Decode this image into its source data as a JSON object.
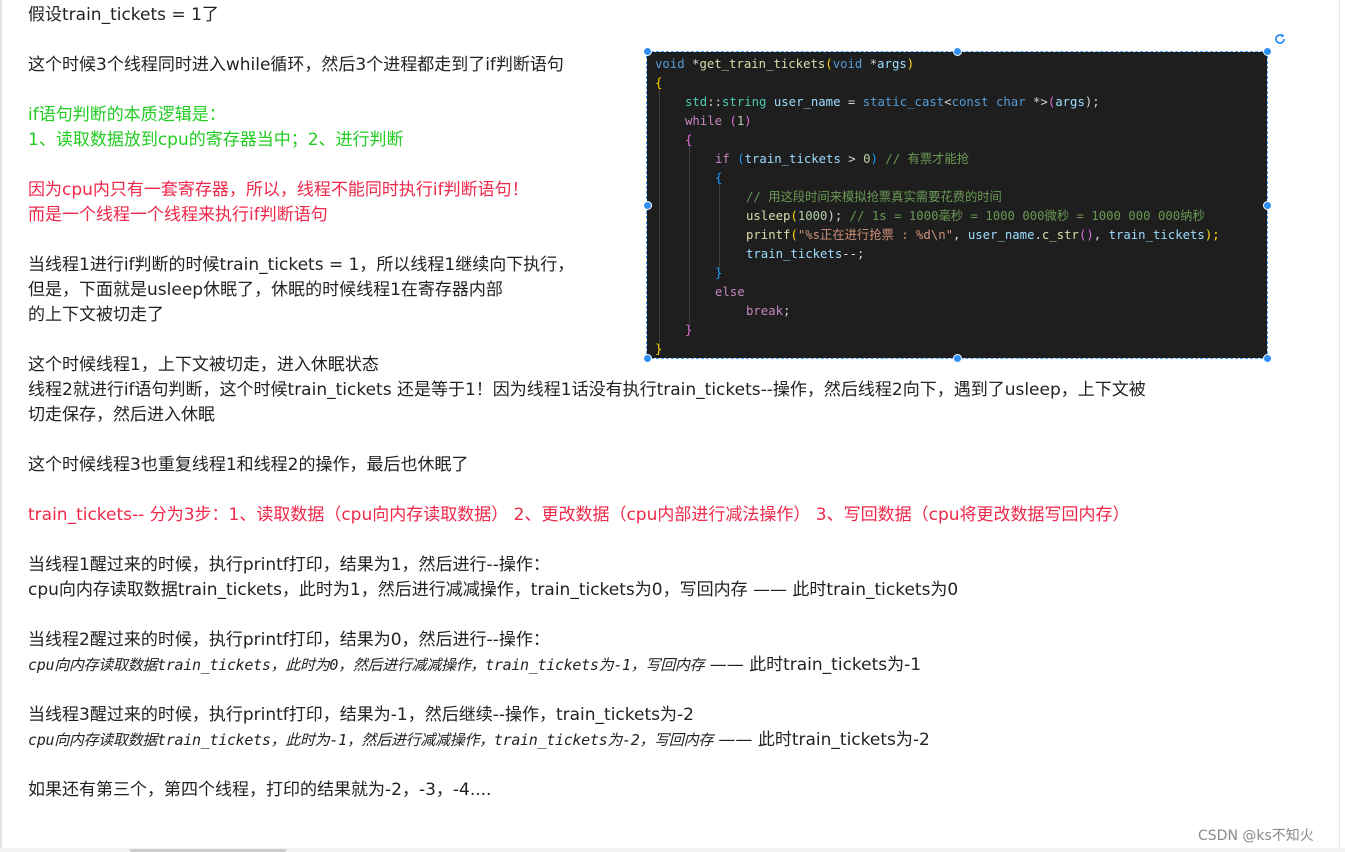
{
  "text": {
    "l1": "假设train_tickets = 1了",
    "l2": "这个时候3个线程同时进入while循环，然后3个进程都走到了if判断语句",
    "l3": "if语句判断的本质逻辑是：",
    "l4": "1、读取数据放到cpu的寄存器当中；2、进行判断",
    "l5": "因为cpu内只有一套寄存器，所以，线程不能同时执行if判断语句！",
    "l6": "而是一个线程一个线程来执行if判断语句",
    "l7": "当线程1进行if判断的时候train_tickets = 1，所以线程1继续向下执行，",
    "l8": "但是，下面就是usleep休眠了，休眠的时候线程1在寄存器内部",
    "l9": "的上下文被切走了",
    "l10": "这个时候线程1，上下文被切走，进入休眠状态",
    "l11": "线程2就进行if语句判断，这个时候train_tickets 还是等于1！因为线程1话没有执行train_tickets--操作，然后线程2向下，遇到了usleep，上下文被",
    "l12": "切走保存，然后进入休眠",
    "l13": "这个时候线程3也重复线程1和线程2的操作，最后也休眠了",
    "l14": "train_tickets-- 分为3步：1、读取数据（cpu向内存读取数据） 2、更改数据（cpu内部进行减法操作） 3、写回数据（cpu将更改数据写回内存）",
    "l15": "当线程1醒过来的时候，执行printf打印，结果为1，然后进行--操作：",
    "l16": "cpu向内存读取数据train_tickets，此时为1，然后进行减减操作，train_tickets为0，写回内存 —— 此时train_tickets为0",
    "l17": "当线程2醒过来的时候，执行printf打印，结果为0，然后进行--操作：",
    "l18a": "cpu向内存读取数据train_tickets，此时为0，然后进行减减操作，train_tickets为-1，写回内存",
    "l18b": " —— 此时train_tickets为-1",
    "l19": "当线程3醒过来的时候，执行printf打印，结果为-1，然后继续--操作，train_tickets为-2",
    "l20a": "cpu向内存读取数据train_tickets，此时为-1，然后进行减减操作，train_tickets为-2，写回内存",
    "l20b": " —— 此时train_tickets为-2",
    "l21": "如果还有第三个，第四个线程，打印的结果就为-2，-3，-4...."
  },
  "code": {
    "c1a": "void",
    "c1b": " *",
    "c1c": "get_train_tickets",
    "c1d": "(",
    "c1e": "void",
    "c1f": " *",
    "c1g": "args",
    "c1h": ")",
    "c2": "{",
    "c3a": "std",
    "c3b": "::",
    "c3c": "string",
    "c3d": " user_name",
    "c3e": " = ",
    "c3f": "static_cast",
    "c3g": "<",
    "c3h": "const char",
    "c3i": " *>",
    "c3j": "(",
    "c3k": "args",
    "c3l": ");",
    "c4a": "while",
    "c4b": " (",
    "c4c": "1",
    "c4d": ")",
    "c5": "{",
    "c6a": "if",
    "c6b": " (",
    "c6c": "train_tickets",
    "c6d": " > ",
    "c6e": "0",
    "c6f": ")",
    "c6g": " // 有票才能抢",
    "c7": "{",
    "c8": "// 用这段时间来模拟抢票真实需要花费的时间",
    "c9a": "usleep",
    "c9b": "(",
    "c9c": "1000",
    "c9d": ");",
    "c9e": " // 1s = 1000毫秒 = 1000 000微秒 = 1000 000 000纳秒",
    "c10a": "printf",
    "c10b": "(",
    "c10c": "\"%s正在进行抢票 : %d\\n\"",
    "c10d": ", ",
    "c10e": "user_name",
    "c10f": ".",
    "c10g": "c_str",
    "c10h": "()",
    "c10i": ", ",
    "c10j": "train_tickets",
    "c10k": ");",
    "c11a": "train_tickets",
    "c11b": "--;",
    "c12": "}",
    "c13": "else",
    "c14a": "break",
    "c14b": ";",
    "c15": "}",
    "c16": "}"
  },
  "colors": {
    "green_text": "#22cc22",
    "red_text": "#f0284a",
    "code_background": "#1e1e1e",
    "selection_handle": "#2f8ff5"
  },
  "icons": {
    "rotate": "rotate-icon"
  },
  "watermark": "CSDN @ks不知火"
}
